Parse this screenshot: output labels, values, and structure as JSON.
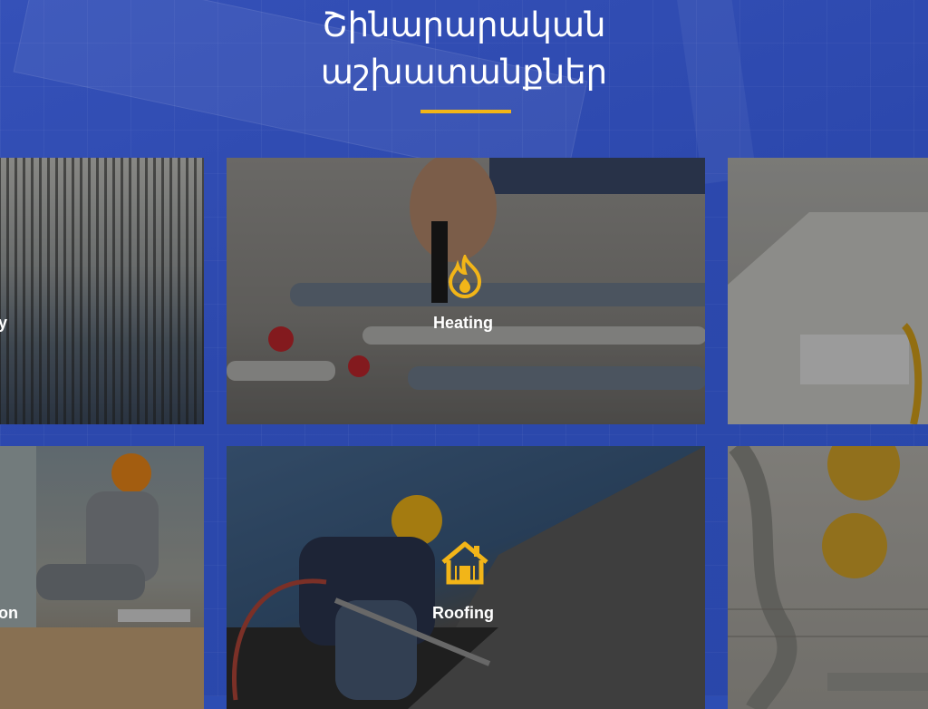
{
  "header": {
    "title_line1": "Շինարարական",
    "title_line2": "աշխատանքներ"
  },
  "cards": [
    {
      "label": "y",
      "icon": "bolt-icon"
    },
    {
      "label": "Heating",
      "icon": "flame-icon"
    },
    {
      "label": "",
      "icon": ""
    },
    {
      "label": "on",
      "icon": ""
    },
    {
      "label": "Roofing",
      "icon": "house-icon"
    },
    {
      "label": "",
      "icon": ""
    }
  ],
  "colors": {
    "background": "#2d4db3",
    "accent": "#f2b518",
    "text": "#ffffff"
  }
}
